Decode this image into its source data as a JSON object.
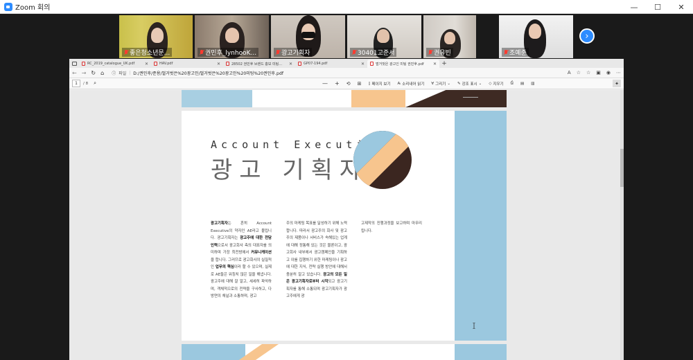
{
  "zoom": {
    "window_title": "Zoom 회의",
    "window_controls": [
      "—",
      "☐",
      "✕"
    ],
    "participants": [
      {
        "name": "좋은청소년문..."
      },
      {
        "name": "권민후_lynhooK..."
      },
      {
        "name": "광고기획자"
      },
      {
        "name": "30401고준서"
      },
      {
        "name": "권유빈"
      },
      {
        "name": "조예준"
      }
    ],
    "next_page_glyph": "›"
  },
  "browser": {
    "tabs": [
      {
        "label": "RC_2019_catalogue_UK.pdf"
      },
      {
        "label": "HAV.pdf"
      },
      {
        "label": "28502 권민후 브랜드 홍보 미팅..."
      },
      {
        "label": "GP07-194.pdf"
      },
      {
        "label": "벌거벗은 광고인 미팅 권민후.pdf"
      }
    ],
    "new_tab_glyph": "+",
    "address": {
      "scheme_label": "파일",
      "url": "D:/권민후/준용/벌거벗은%20광고인/벌거벗은%20광고인%20미팅%20권민후.pdf"
    },
    "pdf_toolbar": {
      "page_current": "1",
      "page_total": "/ 8",
      "items": [
        {
          "icon": "minus-icon",
          "label": "—"
        },
        {
          "icon": "plus-icon",
          "label": "+"
        },
        {
          "icon": "page-view-icon",
          "label": "페이지 보기"
        },
        {
          "icon": "read-aloud-icon",
          "label": "소리내어 읽기"
        },
        {
          "icon": "draw-icon",
          "label": "그리기"
        },
        {
          "icon": "highlight-icon",
          "label": "강조 표시"
        },
        {
          "icon": "eraser-icon",
          "label": "지우기"
        }
      ]
    }
  },
  "document": {
    "title_en": "Account Executive",
    "title_kr": "광고 기획자",
    "col1": [
      {
        "b": "광고기획자",
        "t": "는 흔히 Account Executive의 약자인 AE라고 불립니다. 광고기획자는 "
      },
      {
        "b": "광고주에 대한 전담 인력",
        "t": "으로서 광고회사 측의 대표자를 의미하며 가장 최전방에서 "
      },
      {
        "b": "커뮤니케이션",
        "t": "을 합니다. 그러므로 광고회사의 실질적인 "
      },
      {
        "b": "업무의 핵심",
        "t": "이라 할 수 있으며, 실제로 AE들은 워칭치 많은 일을 해냅니다. 광고주에 대해 잘 알고, 세세히 파악하며, 객체적으로의 전략을 구사하고, 다방면의 채널과 소통하며, 광고"
      }
    ],
    "col2": [
      {
        "b": "",
        "t": "주의 마케팅 목표를 달성하기 위해 노력합니다. 따라서 광고주의 회사 및 광고주의 제품이나 서비스가 속해있는 업계에 대해 정통해 있는 것은 물론이고, 광고회사 내부에서 광고캠페인을 기획하고 이를 집행하기 위한 마케팅이나 광고에 대한 지식, 전략 실행 방안에 대해서 충분히 알고 있습니다. "
      },
      {
        "b": "광고의 모든 일은 광고기획자로부터 시작",
        "t": "되고 광고기획자를 통해 소통되며 광고기획자가 광고주에게 광"
      }
    ],
    "col3": [
      {
        "b": "",
        "t": "고제작의 진행과정을 보고하며 마무리 됩니다."
      }
    ]
  }
}
